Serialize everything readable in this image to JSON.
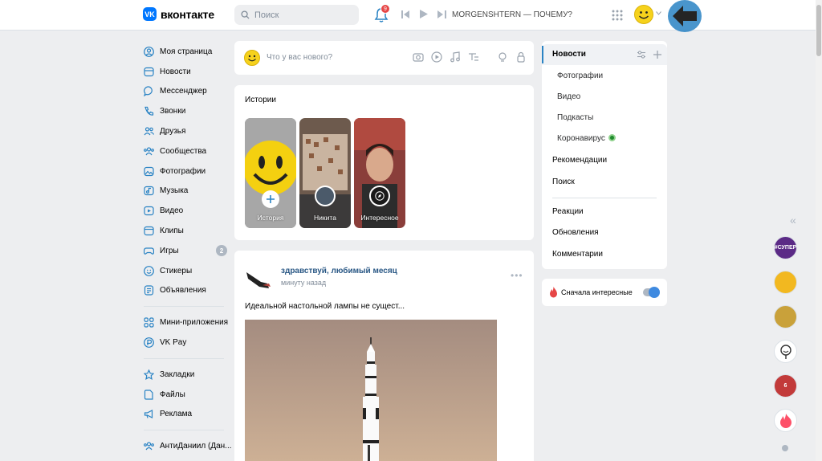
{
  "header": {
    "logo_mark": "VK",
    "logo_text": "вконтакте",
    "search_placeholder": "Поиск",
    "notifications_count": "9",
    "now_playing": "MORGENSHTERN — ПОЧЕМУ?"
  },
  "nav": {
    "group1": [
      {
        "label": "Моя страница",
        "icon": "user-circle-icon"
      },
      {
        "label": "Новости",
        "icon": "news-icon"
      },
      {
        "label": "Мессенджер",
        "icon": "message-icon"
      },
      {
        "label": "Звонки",
        "icon": "phone-icon"
      },
      {
        "label": "Друзья",
        "icon": "friends-icon"
      },
      {
        "label": "Сообщества",
        "icon": "communities-icon"
      },
      {
        "label": "Фотографии",
        "icon": "photo-icon"
      },
      {
        "label": "Музыка",
        "icon": "music-icon"
      },
      {
        "label": "Видео",
        "icon": "video-icon"
      },
      {
        "label": "Клипы",
        "icon": "clips-icon"
      },
      {
        "label": "Игры",
        "icon": "gamepad-icon",
        "badge": "2"
      },
      {
        "label": "Стикеры",
        "icon": "sticker-icon"
      },
      {
        "label": "Объявления",
        "icon": "ads-icon"
      }
    ],
    "group2": [
      {
        "label": "Мини-приложения",
        "icon": "apps-icon"
      },
      {
        "label": "VK Pay",
        "icon": "vkpay-icon"
      }
    ],
    "group3": [
      {
        "label": "Закладки",
        "icon": "star-icon"
      },
      {
        "label": "Файлы",
        "icon": "file-icon"
      },
      {
        "label": "Реклама",
        "icon": "megaphone-icon"
      }
    ],
    "group4": [
      {
        "label": "АнтиДаниил (Дан...",
        "icon": "group-icon"
      }
    ]
  },
  "composer": {
    "placeholder": "Что у вас нового?"
  },
  "stories": {
    "title": "Истории",
    "items": [
      {
        "label": "История"
      },
      {
        "label": "Никита"
      },
      {
        "label": "Интересное"
      }
    ]
  },
  "post": {
    "author": "здравствуй, любимый месяц",
    "time": "минуту назад",
    "more": "•••",
    "text": "Идеальной настольной лампы не сущест..."
  },
  "right_menu": {
    "items": [
      {
        "label": "Новости",
        "active": true
      },
      {
        "label": "Фотографии",
        "sub": true
      },
      {
        "label": "Видео",
        "sub": true
      },
      {
        "label": "Подкасты",
        "sub": true
      },
      {
        "label": "Коронавирус",
        "sub": true
      },
      {
        "label": "Рекомендации"
      },
      {
        "label": "Поиск"
      },
      {
        "label": "Реакции"
      },
      {
        "label": "Обновления"
      },
      {
        "label": "Комментарии"
      }
    ]
  },
  "sort_toggle": {
    "label": "Сначала интересные",
    "on": true
  },
  "chats": {
    "chevron": "«",
    "items": [
      {
        "label": "#СУПЕР",
        "color": "#5b2a86"
      },
      {
        "label": "",
        "color": "#f2b820"
      },
      {
        "label": "",
        "color": "#c9a13a"
      },
      {
        "label": "",
        "color": "#ffffff"
      },
      {
        "label": "6",
        "color": "#c23a3a"
      },
      {
        "label": "",
        "color": "#ffffff"
      }
    ]
  },
  "colors": {
    "accent": "#2a83c4",
    "link": "#2a5885",
    "background": "#edeef0"
  }
}
